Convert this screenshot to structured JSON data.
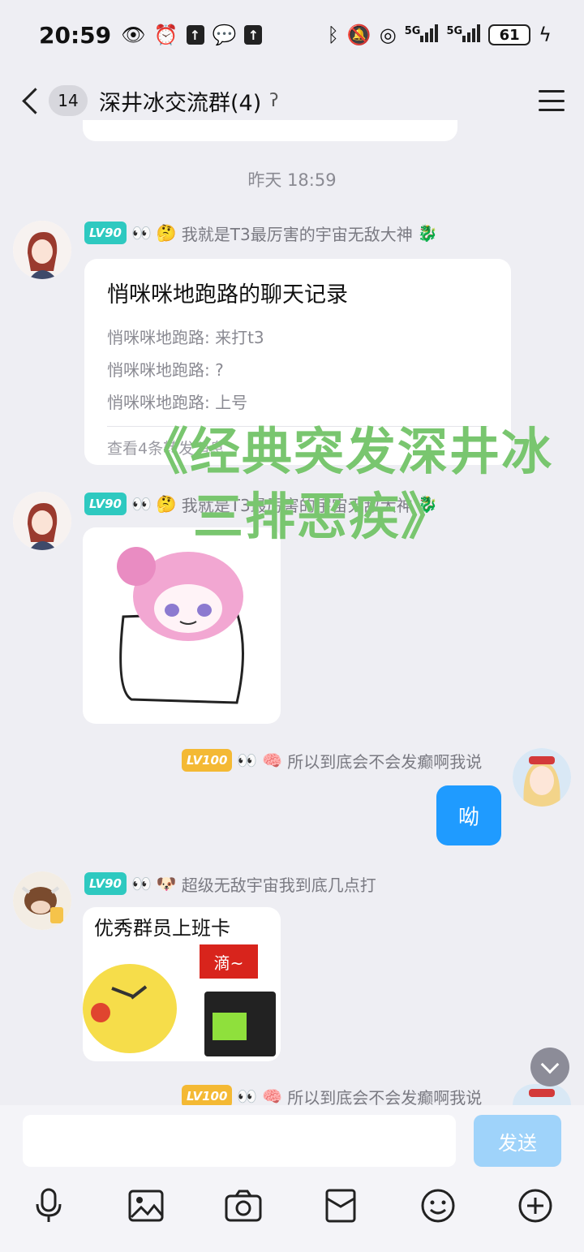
{
  "status_bar": {
    "time": "20:59",
    "net1": "5G",
    "net2": "5G",
    "battery": "61",
    "icons": [
      "eye-icon",
      "alarm-icon",
      "upload-icon",
      "wechat-icon",
      "upload-icon",
      "bluetooth-icon",
      "mute-icon",
      "hotspot-icon",
      "signal-icon",
      "signal-icon",
      "charging-icon"
    ]
  },
  "header": {
    "unread_count": "14",
    "title": "深井冰交流群(4)",
    "icons": [
      "back-icon",
      "ear-icon",
      "menu-icon"
    ]
  },
  "timestamp": "昨天 18:59",
  "messages": [
    {
      "level": "LV90",
      "sender": "我就是T3最厉害的宇宙无敌大神",
      "record": {
        "title": "悄咪咪地跑路的聊天记录",
        "lines": [
          "悄咪咪地跑路: 来打t3",
          "悄咪咪地跑路: ?",
          "悄咪咪地跑路: 上号"
        ],
        "footer": "查看4条转发消息"
      }
    },
    {
      "level": "LV90",
      "sender": "我就是T3最厉害的宇宙无敌大神",
      "sticker": "pink-hair-girl-pillow"
    },
    {
      "level": "LV100",
      "sender": "所以到底会不会发癫啊我说",
      "text": "呦"
    },
    {
      "level": "LV90",
      "sender": "超级无敌宇宙我到底几点打",
      "sticker_text": "优秀群员上班卡",
      "sticker_badge": "滴~"
    },
    {
      "level": "LV100",
      "sender": "所以到底会不会发癫啊我说"
    }
  ],
  "overlay": {
    "line1": "《经典突发深井冰",
    "line2": "三排恶疾》",
    "color": "#79c66f"
  },
  "input": {
    "placeholder": "",
    "send_label": "发送"
  },
  "toolbar_icons": [
    "microphone-icon",
    "image-icon",
    "camera-icon",
    "red-packet-icon",
    "emoji-icon",
    "plus-icon"
  ],
  "colors": {
    "accent": "#1f9bff",
    "send_disabled": "#9fd3fa",
    "level_teal": "#2ec9c0",
    "level_gold": "#f4b934"
  }
}
